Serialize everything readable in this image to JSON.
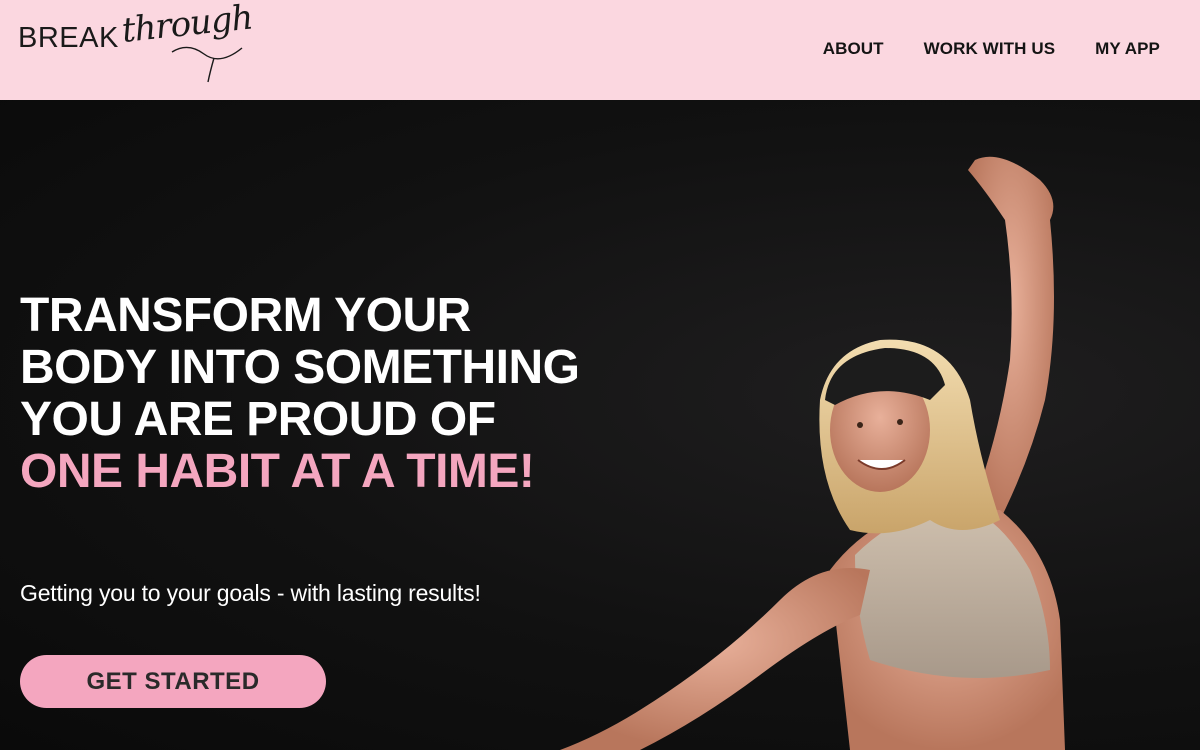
{
  "header": {
    "logo": {
      "caps": "BREAK",
      "script": "through"
    },
    "nav": [
      {
        "label": "ABOUT"
      },
      {
        "label": "WORK WITH US"
      },
      {
        "label": "MY APP"
      }
    ]
  },
  "hero": {
    "headline_main": "TRANSFORM YOUR BODY INTO SOMETHING YOU ARE PROUD OF ",
    "headline_accent": "ONE HABIT AT A TIME!",
    "subhead": "Getting you to your goals - with lasting results!",
    "cta_label": "GET STARTED"
  },
  "colors": {
    "header_bg": "#fbd7e0",
    "accent_pink": "#f4a6bf",
    "hero_bg": "#0d0d0d"
  }
}
